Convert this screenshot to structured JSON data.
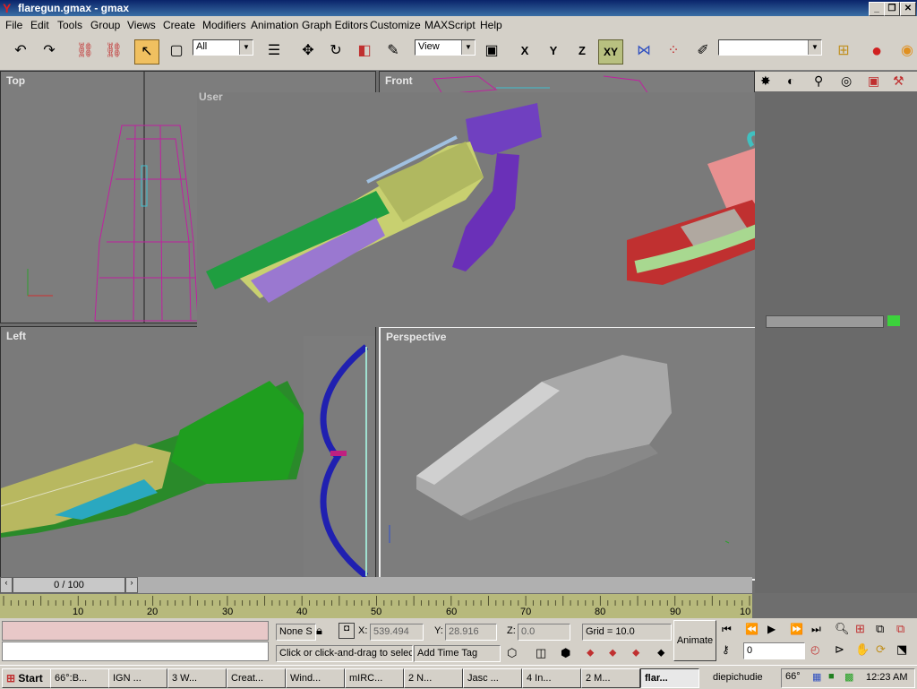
{
  "window": {
    "title": "flaregun.gmax - gmax"
  },
  "menu": [
    "File",
    "Edit",
    "Tools",
    "Group",
    "Views",
    "Create",
    "Modifiers",
    "Animation",
    "Graph Editors",
    "Customize",
    "MAXScript",
    "Help"
  ],
  "toolbar": {
    "selection_filter": "All",
    "ref_coord": "View",
    "axis_x": "X",
    "axis_y": "Y",
    "axis_z": "Z",
    "axis_xy": "XY"
  },
  "viewports": {
    "top": "Top",
    "front": "Front",
    "left": "Left",
    "perspective": "Perspective",
    "float_partial": "User"
  },
  "timeline": {
    "frame": "0 / 100",
    "ticks": [
      "10",
      "20",
      "30",
      "40",
      "50",
      "60",
      "70",
      "80",
      "90",
      "10"
    ]
  },
  "status": {
    "selection": "None S",
    "x_label": "X:",
    "x_value": "539.494",
    "y_label": "Y:",
    "y_value": "28.916",
    "z_label": "Z:",
    "z_value": "0.0",
    "grid": "Grid = 10.0",
    "prompt": "Click or click-and-drag to selec",
    "add_time_tag": "Add Time Tag",
    "animate": "Animate",
    "frame_field": "0"
  },
  "taskbar": {
    "start": "Start",
    "tasks": [
      "66°:B...",
      "IGN ...",
      "3 W...",
      "Creat...",
      "Wind...",
      "mIRC...",
      "2 N...",
      "Jasc ...",
      "4 In...",
      "2 M...",
      "flar..."
    ],
    "user": "diepichudie",
    "temp": "66°",
    "clock": "12:23 AM"
  },
  "colors": {
    "titlebar": "#0a246a",
    "viewport_bg": "#7d7d7d",
    "ruler": "#b7b97c",
    "accent_green": "#3cd23c"
  }
}
